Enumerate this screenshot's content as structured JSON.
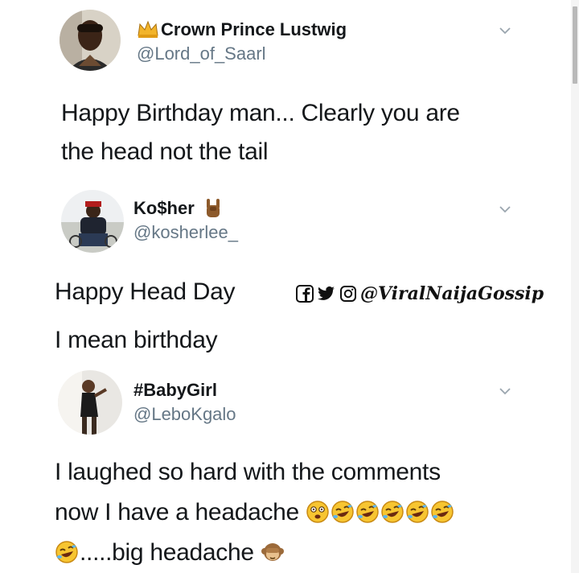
{
  "tweets": [
    {
      "name": "Crown Prince Lustwig",
      "handle": "@Lord_of_Saarl",
      "lines": [
        "Happy Birthday man... Clearly you are",
        "the head not the tail"
      ]
    },
    {
      "name": "Ko$her",
      "handle": "@kosherlee_",
      "lines": [
        "Happy Head Day",
        "I mean birthday"
      ]
    },
    {
      "name": "#BabyGirl",
      "handle": "@LeboKgalo",
      "lines": [
        "I laughed so hard with the comments",
        "now I have a headache",
        ".....big headache"
      ]
    }
  ],
  "watermark": {
    "handle": "@ViralNaijaGossip",
    "icons": [
      "facebook-icon",
      "twitter-icon",
      "instagram-icon"
    ]
  },
  "emojis": {
    "tweet1_badge": "crown-emoji",
    "tweet2_badge": "rock-hand-emoji",
    "tweet3_line2": [
      "dizzy-face-emoji",
      "rolling-laughing-emoji",
      "rolling-laughing-emoji",
      "rolling-laughing-emoji",
      "rolling-laughing-emoji",
      "rolling-laughing-emoji"
    ],
    "tweet3_line3_start": "rolling-laughing-emoji",
    "tweet3_line3_end": "see-no-evil-monkey-emoji"
  },
  "colors": {
    "text": "#14171a",
    "handle": "#657786",
    "chevron": "#9aa5ae"
  }
}
